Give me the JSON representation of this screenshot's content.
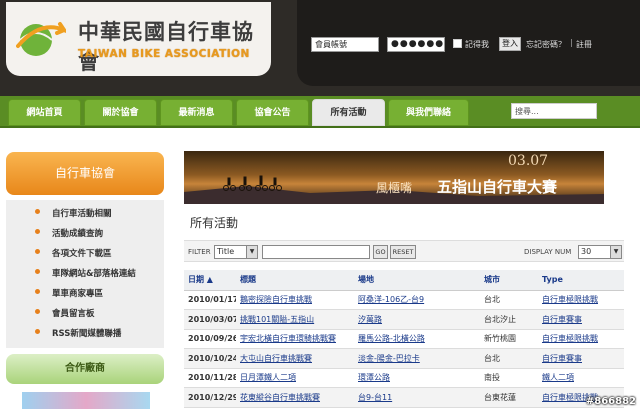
{
  "header": {
    "logo_zh": "中華民國自行車協會",
    "logo_en": "TAIWAN BIKE ASSOCIATION",
    "login": {
      "account_value": "會員帳號",
      "password_value": "●●●●●●",
      "remember_label": "記得我",
      "login_button": "登入",
      "forgot_link": "忘記密碼？",
      "separator": "|",
      "register_link": "註冊"
    }
  },
  "nav": {
    "items": [
      {
        "label": "網站首頁"
      },
      {
        "label": "關於協會"
      },
      {
        "label": "最新消息"
      },
      {
        "label": "協會公告"
      },
      {
        "label": "所有活動"
      },
      {
        "label": "與我們聯絡"
      }
    ],
    "active_index": 4,
    "search_value": "搜尋..."
  },
  "sidebar": {
    "title": "自行車協會",
    "items": [
      {
        "label": "自行車活動相關"
      },
      {
        "label": "活動成績查詢"
      },
      {
        "label": "各項文件下載區"
      },
      {
        "label": "車隊網站&部落格連結"
      },
      {
        "label": "單車商家專區"
      },
      {
        "label": "會員留言板"
      },
      {
        "label": "RSS新聞媒體聯播"
      }
    ],
    "partner_title": "合作廠商"
  },
  "banner": {
    "date": "03.07",
    "place": "風櫃嘴",
    "event": "五指山自行車大賽"
  },
  "main": {
    "title": "所有活動",
    "filter": {
      "label": "FILTER",
      "select_value": "Title",
      "go": "GO",
      "reset": "RESET",
      "display_label": "DISPLAY NUM",
      "display_value": "30"
    },
    "table": {
      "headers": [
        "日期 ▲",
        "標題",
        "場地",
        "城市",
        "Type"
      ],
      "rows": [
        {
          "date": "2010/01/17",
          "title": "鵝密探險自行車挑戰",
          "venue": "阿桑洋-106乙-台9",
          "city": "台北",
          "type": "自行車極限挑戰"
        },
        {
          "date": "2010/03/07",
          "title": "挑戰101關隘-五指山",
          "venue": "汐萬路",
          "city": "台北汐止",
          "type": "自行車賽事"
        },
        {
          "date": "2010/09/26",
          "title": "宇宏北橫自行車環騎挑戰賽",
          "venue": "羅馬公路-北橫公路",
          "city": "新竹桃園",
          "type": "自行車極限挑戰"
        },
        {
          "date": "2010/10/24",
          "title": "大屯山自行車挑戰賽",
          "venue": "淡金-陽金-巴拉卡",
          "city": "台北",
          "type": "自行車賽事"
        },
        {
          "date": "2010/11/28",
          "title": "日月潭鐵人二項",
          "venue": "環潭公路",
          "city": "南投",
          "type": "鐵人二項"
        },
        {
          "date": "2010/12/29",
          "title": "花東縱谷自行車挑戰賽",
          "venue": "台9-台11",
          "city": "台東花蓮",
          "type": "自行車極限挑戰"
        }
      ]
    }
  },
  "watermark": "#866882",
  "colors": {
    "header_bg": "#2e2b27",
    "nav_green": "#77b033",
    "sidebar_orange": "#e8871a",
    "link_blue": "#1a3a8a"
  }
}
